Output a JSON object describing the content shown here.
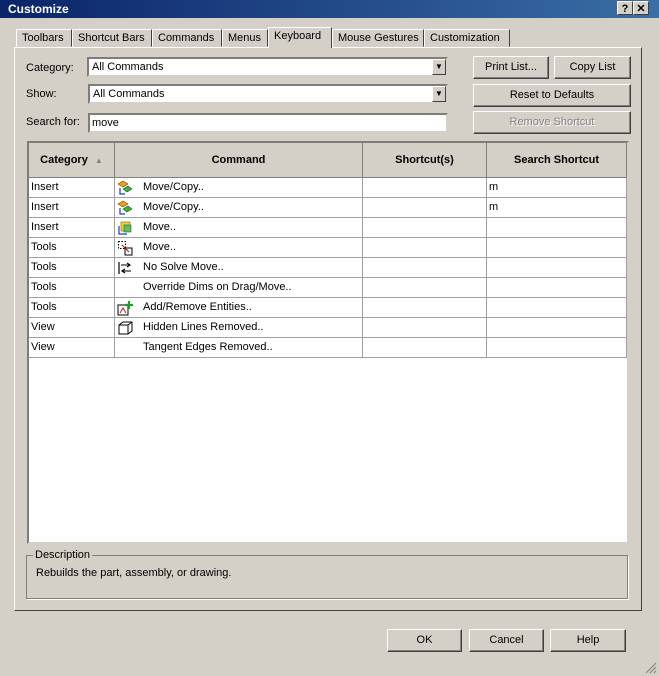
{
  "window": {
    "title": "Customize",
    "help_glyph": "?",
    "close_glyph": "✕"
  },
  "tabs": [
    {
      "label": "Toolbars"
    },
    {
      "label": "Shortcut Bars"
    },
    {
      "label": "Commands"
    },
    {
      "label": "Menus"
    },
    {
      "label": "Keyboard",
      "active": true
    },
    {
      "label": "Mouse Gestures"
    },
    {
      "label": "Customization"
    }
  ],
  "filters": {
    "category_label": "Category:",
    "category_value": "All Commands",
    "show_label": "Show:",
    "show_value": "All Commands",
    "search_label": "Search for:",
    "search_value": "move"
  },
  "buttons": {
    "print_list": "Print List...",
    "copy_list": "Copy List",
    "reset_defaults": "Reset to Defaults",
    "remove_shortcut": "Remove Shortcut",
    "ok": "OK",
    "cancel": "Cancel",
    "help": "Help"
  },
  "table": {
    "columns": [
      "Category",
      "Command",
      "Shortcut(s)",
      "Search Shortcut"
    ],
    "sort_indicator": "▲",
    "rows": [
      {
        "category": "Insert",
        "command": "Move/Copy..",
        "shortcut": "",
        "search": "m",
        "icon": "move-copy-icon"
      },
      {
        "category": "Insert",
        "command": "Move/Copy..",
        "shortcut": "",
        "search": "m",
        "icon": "move-copy-icon"
      },
      {
        "category": "Insert",
        "command": "Move..",
        "shortcut": "",
        "search": "",
        "icon": "move-face-icon"
      },
      {
        "category": "Tools",
        "command": "Move..",
        "shortcut": "",
        "search": "",
        "icon": "move-sketch-icon"
      },
      {
        "category": "Tools",
        "command": "No Solve Move..",
        "shortcut": "",
        "search": "",
        "icon": "no-solve-move-icon"
      },
      {
        "category": "Tools",
        "command": "Override Dims on Drag/Move..",
        "shortcut": "",
        "search": "",
        "icon": ""
      },
      {
        "category": "Tools",
        "command": "Add/Remove Entities..",
        "shortcut": "",
        "search": "",
        "icon": "add-remove-entities-icon"
      },
      {
        "category": "View",
        "command": "Hidden Lines Removed..",
        "shortcut": "",
        "search": "",
        "icon": "hidden-lines-removed-icon"
      },
      {
        "category": "View",
        "command": "Tangent Edges Removed..",
        "shortcut": "",
        "search": "",
        "icon": ""
      }
    ]
  },
  "description": {
    "legend": "Description",
    "text": "Rebuilds the part, assembly, or drawing."
  }
}
